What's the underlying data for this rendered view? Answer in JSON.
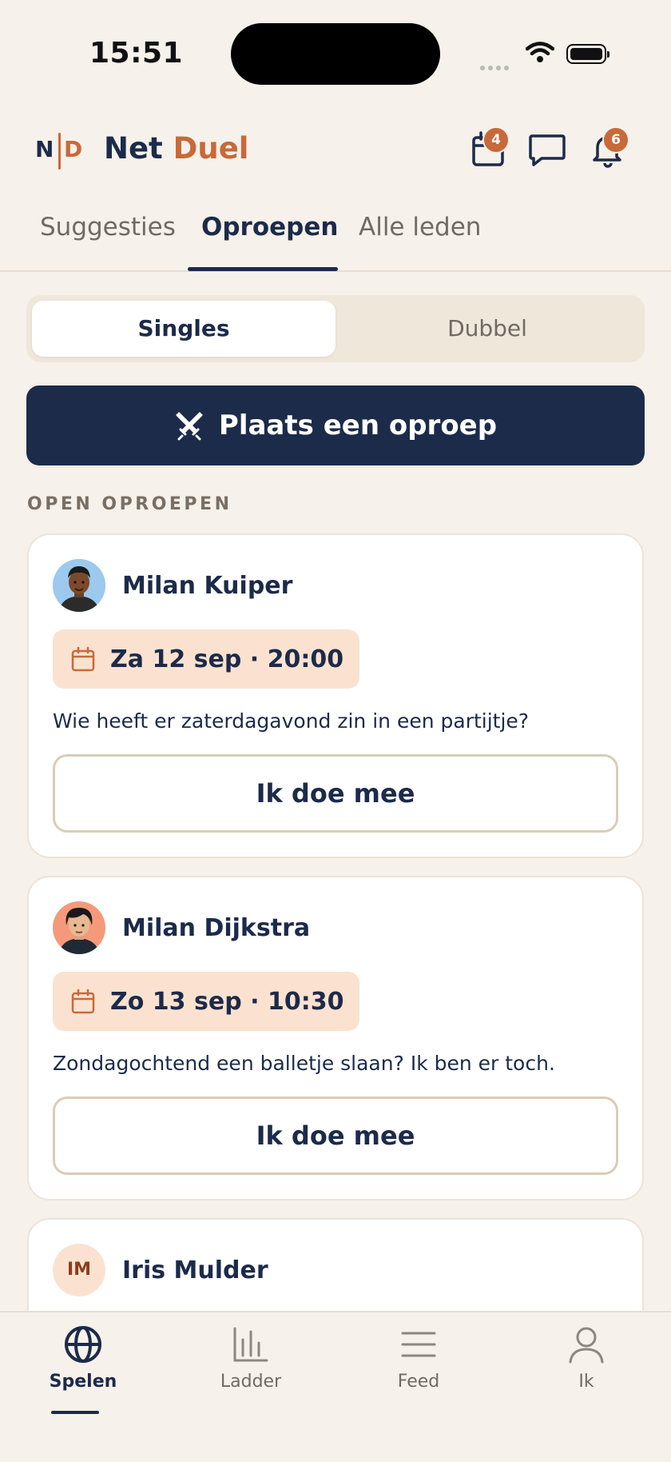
{
  "status_bar": {
    "time": "15:51"
  },
  "header": {
    "logo_left": "N",
    "logo_right": "D",
    "app_name_part1": "Net",
    "app_name_part2": "Duel",
    "icons": [
      {
        "name": "calendar-icon",
        "badge": "4"
      },
      {
        "name": "chat-icon",
        "badge": ""
      },
      {
        "name": "bell-icon",
        "badge": "6"
      }
    ]
  },
  "tabs": [
    {
      "label": "Suggesties",
      "active": false
    },
    {
      "label": "Oproepen",
      "active": true
    },
    {
      "label": "Alle leden",
      "active": false
    }
  ],
  "segment": {
    "singles": "Singles",
    "dubbel": "Dubbel",
    "selected": "Singles"
  },
  "cta": {
    "label": "Plaats een oproep",
    "icon": "crossed-swords-icon"
  },
  "section_title": "OPEN OPROEPEN",
  "calls": [
    {
      "name": "Milan Kuiper",
      "date": "Za 12 sep · 20:00",
      "message": "Wie heeft er zaterdagavond zin in een partijtje?",
      "button": "Ik doe mee"
    },
    {
      "name": "Milan Dijkstra",
      "date": "Zo 13 sep · 10:30",
      "message": "Zondagochtend een balletje slaan? Ik ben er toch.",
      "button": "Ik doe mee"
    },
    {
      "name": "Iris Mulder",
      "initials": "IM"
    }
  ],
  "bottom_nav": [
    {
      "label": "Spelen",
      "icon": "globe-icon",
      "active": true
    },
    {
      "label": "Ladder",
      "icon": "bar-chart-icon",
      "active": false
    },
    {
      "label": "Feed",
      "icon": "menu-lines-icon",
      "active": false
    },
    {
      "label": "Ik",
      "icon": "person-icon",
      "active": false
    }
  ],
  "colors": {
    "navy": "#1c2b4a",
    "accent": "#c8693a",
    "background": "#f6f1ea",
    "date_chip": "#fbe2d0"
  }
}
